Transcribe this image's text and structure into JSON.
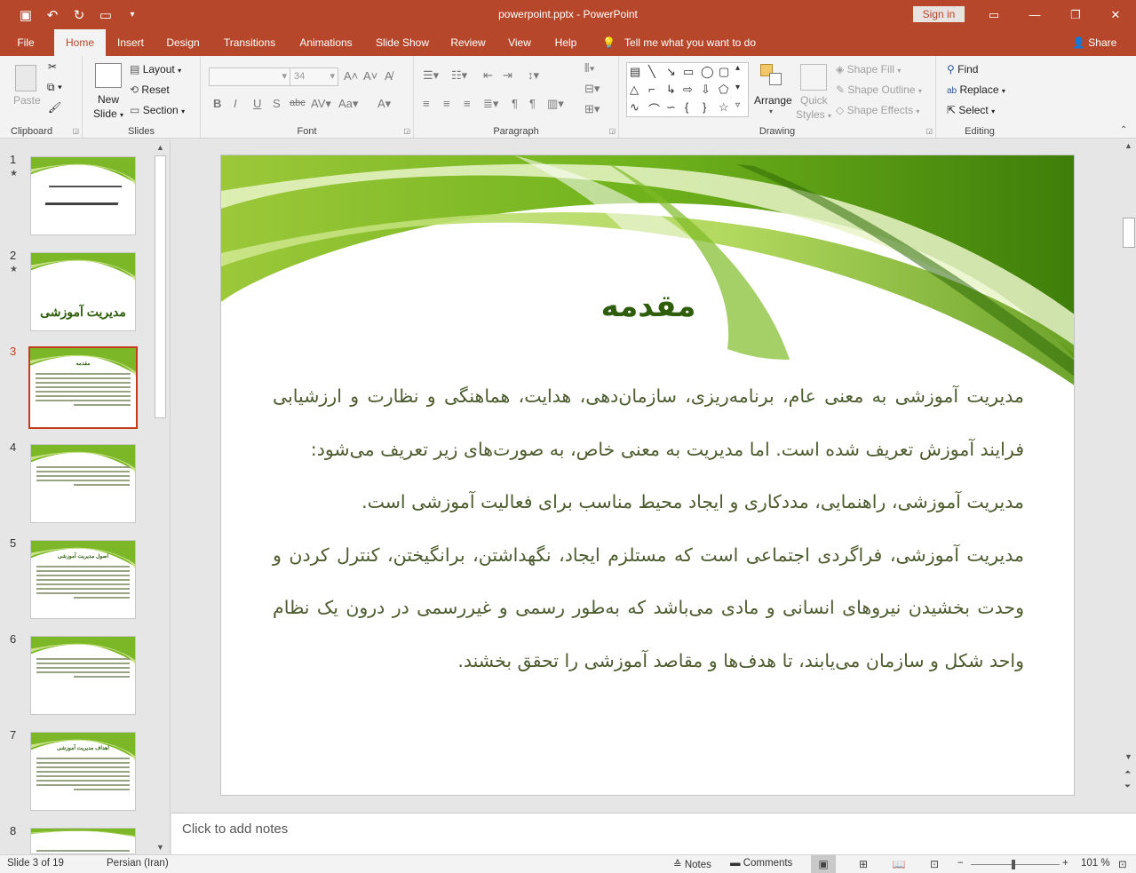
{
  "app": {
    "doc_title": "powerpoint.pptx  -  PowerPoint",
    "sign_in": "Sign in",
    "tell_me": "Tell me what you want to do",
    "share": "Share"
  },
  "tabs": [
    "File",
    "Home",
    "Insert",
    "Design",
    "Transitions",
    "Animations",
    "Slide Show",
    "Review",
    "View",
    "Help"
  ],
  "ribbon": {
    "clipboard": {
      "label": "Clipboard",
      "paste": "Paste"
    },
    "slides": {
      "label": "Slides",
      "new_slide_1": "New",
      "new_slide_2": "Slide",
      "layout": "Layout",
      "reset": "Reset",
      "section": "Section"
    },
    "font": {
      "label": "Font",
      "size": "34"
    },
    "paragraph": {
      "label": "Paragraph"
    },
    "drawing": {
      "label": "Drawing",
      "arrange": "Arrange",
      "quick_styles_1": "Quick",
      "quick_styles_2": "Styles",
      "shape_fill": "Shape Fill",
      "shape_outline": "Shape Outline",
      "shape_effects": "Shape Effects"
    },
    "editing": {
      "label": "Editing",
      "find": "Find",
      "replace": "Replace",
      "select": "Select"
    }
  },
  "thumbnails": [
    {
      "num": "1",
      "star": "★",
      "kind": "calligraphy"
    },
    {
      "num": "2",
      "star": "★",
      "kind": "title",
      "title": "مدیریت آموزشی"
    },
    {
      "num": "3",
      "star": "",
      "kind": "content",
      "title": "مقدمه",
      "active": true
    },
    {
      "num": "4",
      "star": "",
      "kind": "text"
    },
    {
      "num": "5",
      "star": "",
      "kind": "content",
      "title": "اصول مدیریت آموزشی"
    },
    {
      "num": "6",
      "star": "",
      "kind": "text"
    },
    {
      "num": "7",
      "star": "",
      "kind": "content",
      "title": "اهداف مدیریت آموزشی"
    },
    {
      "num": "8",
      "star": "",
      "kind": "text"
    }
  ],
  "slide": {
    "title": "مقدمه",
    "paragraphs": [
      "مدیریت آموزشی به معنی عام، برنامه‌ریزی، سازمان‌دهی، هدایت، هماهنگی و نظارت و ارزشیابی فرایند آموزش تعریف شده است. اما مدیریت به معنی خاص، به صورت‌های زیر تعریف می‌شود:",
      "مدیریت آموزشی، راهنمایی، مددکاری و ایجاد محیط مناسب برای فعالیت آموزشی است.",
      "مدیریت آموزشی، فراگردی اجتماعی است که مستلزم ایجاد، نگهداشتن، برانگیختن، کنترل کردن و وحدت بخشیدن نیروهای انسانی و مادی می‌باشد که به‌طور رسمی و غیررسمی در درون یک نظام واحد شکل و سازمان می‌یابند، تا هدف‌ها و مقاصد آموزشی را تحقق بخشند."
    ]
  },
  "notes_placeholder": "Click to add notes",
  "status": {
    "slide_info": "Slide 3 of 19",
    "language": "Persian (Iran)",
    "notes": "Notes",
    "comments": "Comments",
    "zoom": "101 %",
    "minus": "−",
    "plus": "+"
  },
  "colors": {
    "accent": "#b7472a",
    "slide_title": "#2e5d0c",
    "slide_text": "#4d5c2f",
    "active_thumb": "#c43e1c"
  }
}
